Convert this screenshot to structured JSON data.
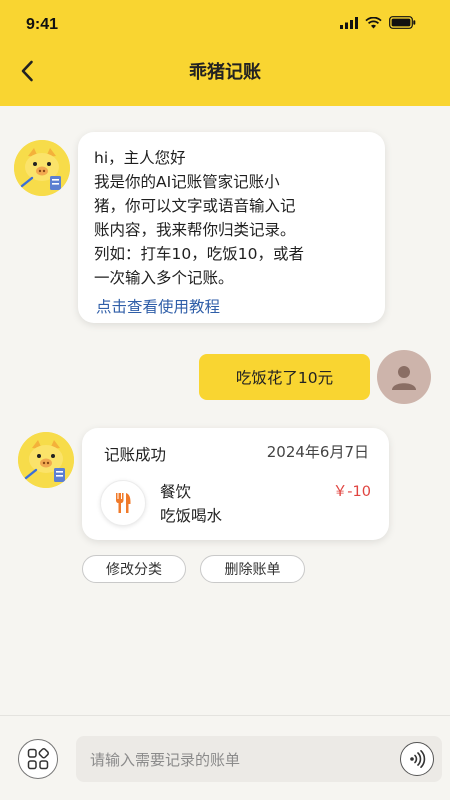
{
  "status_bar": {
    "time": "9:41"
  },
  "header": {
    "title": "乖猪记账"
  },
  "intro": {
    "lines": [
      "hi，主人您好",
      "我是你的AI记账管家记账小",
      "猪，你可以文字或语音输入记",
      "账内容，我来帮你归类记录。",
      "列如：打车10，吃饭10，或者",
      "一次输入多个记账。"
    ],
    "link": "点击查看使用教程"
  },
  "user_message": "吃饭花了10元",
  "record": {
    "status": "记账成功",
    "date": "2024年6月7日",
    "category": "餐饮",
    "note": "吃饭喝水",
    "amount": "￥-10",
    "category_icon": "utensils-icon"
  },
  "actions": {
    "edit_category": "修改分类",
    "delete_bill": "删除账单"
  },
  "input": {
    "placeholder": "请输入需要记录的账单"
  },
  "colors": {
    "accent": "#f9d531",
    "amount_negative": "#e0433f",
    "link": "#2f5ea8",
    "category_icon": "#f07a2a"
  }
}
